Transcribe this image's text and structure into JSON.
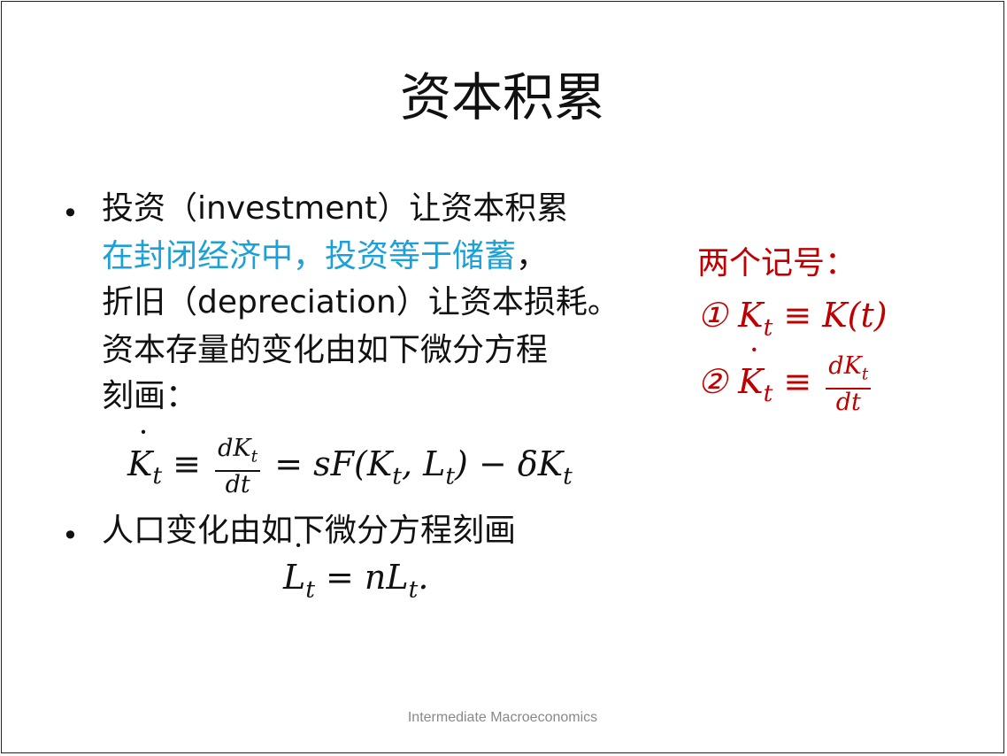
{
  "slide": {
    "title": "资本积累",
    "bullets": [
      {
        "marker": "•",
        "lines": [
          "投资（investment）让资本积累",
          "在封闭经济中，投资等于储蓄",
          "，",
          "折旧（depreciation）让资本损耗。",
          "资本存量的变化由如下微分方程",
          "刻画："
        ]
      },
      {
        "marker": "•",
        "lines": [
          "人口变化由如下微分方程刻画"
        ]
      }
    ],
    "equations": {
      "capital": {
        "lhs": "K",
        "sub": "t",
        "equiv": "≡",
        "frac_num": "dK",
        "frac_num_sub": "t",
        "frac_den": "dt",
        "rhs": "= sF(K",
        "rhs_sub1": "t",
        "rhs_mid": ", L",
        "rhs_sub2": "t",
        "rhs_end": ") − δK",
        "rhs_sub3": "t"
      },
      "labor": {
        "lhs": "L",
        "sub": "t",
        "rhs": "= nL",
        "rhs_sub": "t",
        "end": "."
      }
    },
    "notation": {
      "heading": "两个记号：",
      "item1": {
        "marker": "①",
        "lhs": "K",
        "sub": "t",
        "rhs": "≡ K(t)"
      },
      "item2": {
        "marker": "②",
        "lhs": "K",
        "sub": "t",
        "equiv": "≡",
        "frac_num": "dK",
        "frac_num_sub": "t",
        "frac_den": "dt"
      }
    },
    "footer": "Intermediate Macroeconomics"
  },
  "colors": {
    "highlight_text": "#1ba1d8",
    "notation_text": "#c00000",
    "footer_text": "#888888"
  }
}
